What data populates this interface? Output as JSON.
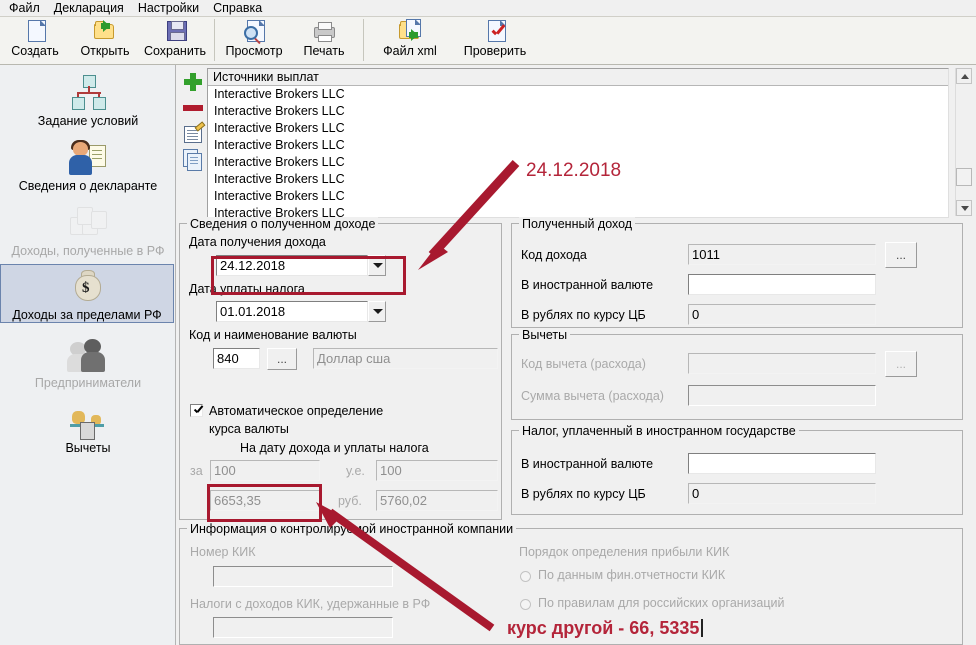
{
  "menu": {
    "items": [
      "Файл",
      "Декларация",
      "Настройки",
      "Справка"
    ]
  },
  "toolbar": {
    "buttons": [
      {
        "label": "Создать",
        "icon": "new-document-icon"
      },
      {
        "label": "Открыть",
        "icon": "open-folder-icon"
      },
      {
        "label": "Сохранить",
        "icon": "save-diskette-icon"
      },
      {
        "label": "Просмотр",
        "icon": "preview-magnifier-icon"
      },
      {
        "label": "Печать",
        "icon": "printer-icon"
      },
      {
        "label": "Файл xml",
        "icon": "export-xml-icon"
      },
      {
        "label": "Проверить",
        "icon": "verify-check-icon"
      }
    ]
  },
  "sidebar": {
    "items": [
      {
        "label": "Задание условий",
        "icon": "conditions-tree-icon",
        "state": "enabled"
      },
      {
        "label": "Сведения о декларанте",
        "icon": "declarant-person-icon",
        "state": "enabled"
      },
      {
        "label": "Доходы, полученные в РФ",
        "icon": "income-coins-icon",
        "state": "disabled"
      },
      {
        "label": "Доходы за пределами РФ",
        "icon": "income-moneybag-icon",
        "state": "selected"
      },
      {
        "label": "Предприниматели",
        "icon": "entrepreneurs-icon",
        "state": "disabled"
      },
      {
        "label": "Вычеты",
        "icon": "deductions-scale-icon",
        "state": "enabled"
      }
    ]
  },
  "list_panel": {
    "tools": [
      {
        "name": "add-icon",
        "title": "+"
      },
      {
        "name": "remove-icon",
        "title": "-"
      },
      {
        "name": "edit-icon",
        "title": "edit"
      },
      {
        "name": "copy-icon",
        "title": "copy"
      }
    ],
    "column_header": "Источники выплат",
    "rows": [
      "Interactive Brokers LLC",
      "Interactive Brokers LLC",
      "Interactive Brokers LLC",
      "Interactive Brokers LLC",
      "Interactive Brokers LLC",
      "Interactive Brokers LLC",
      "Interactive Brokers LLC",
      "Interactive Brokers LLC"
    ]
  },
  "income_details": {
    "title": "Сведения о полученном доходе",
    "date_received_label": "Дата получения дохода",
    "date_received_value": "24.12.2018",
    "date_tax_label": "Дата уплаты налога",
    "date_tax_value": "01.01.2018",
    "currency_label": "Код и наименование валюты",
    "currency_code": "840",
    "currency_browse": "...",
    "currency_name": "Доллар сша",
    "auto_rate_label": "Автоматическое определение",
    "auto_rate_label2": "курса валюты",
    "on_date_label": "На дату дохода и уплаты налога",
    "per_label": "за",
    "per_value": "100",
    "ue_label": "у.е.",
    "ue_value": "100",
    "rate_value": "6653,35",
    "rub_label": "руб.",
    "rub_value": "5760,02"
  },
  "received_income": {
    "title": "Полученный доход",
    "code_label": "Код дохода",
    "code_value": "1011",
    "code_browse": "...",
    "foreign_currency_label": "В иностранной валюте",
    "foreign_currency_value": "",
    "rub_cb_label": "В рублях по курсу ЦБ",
    "rub_cb_value": "0"
  },
  "deductions": {
    "title": "Вычеты",
    "code_label": "Код вычета (расхода)",
    "code_value": "",
    "code_browse": "...",
    "sum_label": "Сумма вычета (расхода)",
    "sum_value": ""
  },
  "foreign_tax": {
    "title": "Налог, уплаченный в иностранном государстве",
    "foreign_currency_label": "В иностранной валюте",
    "foreign_currency_value": "",
    "rub_cb_label": "В рублях по курсу ЦБ",
    "rub_cb_value": "0"
  },
  "cfc": {
    "title": "Информация о контролируемой иностранной компании",
    "number_label": "Номер КИК",
    "number_value": "",
    "taxes_label": "Налоги с доходов КИК, удержанные в РФ",
    "taxes_value": "",
    "profit_order_label": "Порядок определения прибыли КИК",
    "option1": "По данным фин.отчетности КИК",
    "option2": "По правилам для российских организаций"
  },
  "annotations": {
    "date_note": "24.12.2018",
    "rate_note": "курс другой - 66, 5335",
    "accent_color": "#b4253a"
  }
}
